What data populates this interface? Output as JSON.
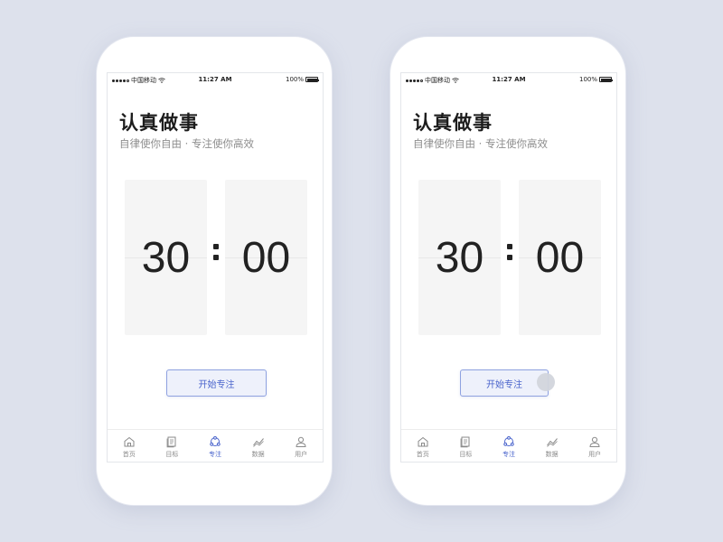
{
  "status_bar": {
    "carrier": "中国移动",
    "time": "11:27 AM",
    "battery": "100%"
  },
  "header": {
    "title": "认真做事",
    "subtitle": "自律使你自由 · 专注使你高效"
  },
  "timer": {
    "minutes": "30",
    "seconds": "00"
  },
  "start_button": {
    "label": "开始专注"
  },
  "tabs": [
    {
      "label": "首页",
      "icon": "home-icon"
    },
    {
      "label": "目标",
      "icon": "document-icon"
    },
    {
      "label": "专注",
      "icon": "focus-icon",
      "active": true
    },
    {
      "label": "数据",
      "icon": "chart-icon"
    },
    {
      "label": "用户",
      "icon": "user-icon"
    }
  ],
  "colors": {
    "accent": "#4a64cc",
    "background": "#dde1ec",
    "card": "#f5f5f5"
  }
}
